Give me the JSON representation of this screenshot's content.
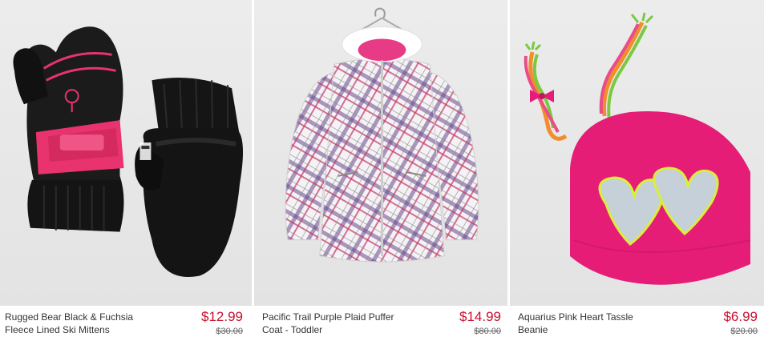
{
  "products": [
    {
      "name_line1": "Rugged Bear Black & Fuchsia",
      "name_line2": "Fleece Lined Ski Mittens",
      "price": "$12.99",
      "original_price": "$30.00"
    },
    {
      "name_line1": "Pacific Trail Purple Plaid Puffer",
      "name_line2": "Coat - Toddler",
      "price": "$14.99",
      "original_price": "$80.00"
    },
    {
      "name_line1": "Aquarius Pink Heart Tassle",
      "name_line2": "Beanie",
      "price": "$6.99",
      "original_price": "$20.00"
    }
  ],
  "colors": {
    "price": "#c8102e",
    "photo_background": "#e8e8e8",
    "fuchsia": "#e8336f",
    "black": "#1a1a1a",
    "beanie_pink": "#e51d77",
    "plaid_purple": "#6a4a8c"
  }
}
